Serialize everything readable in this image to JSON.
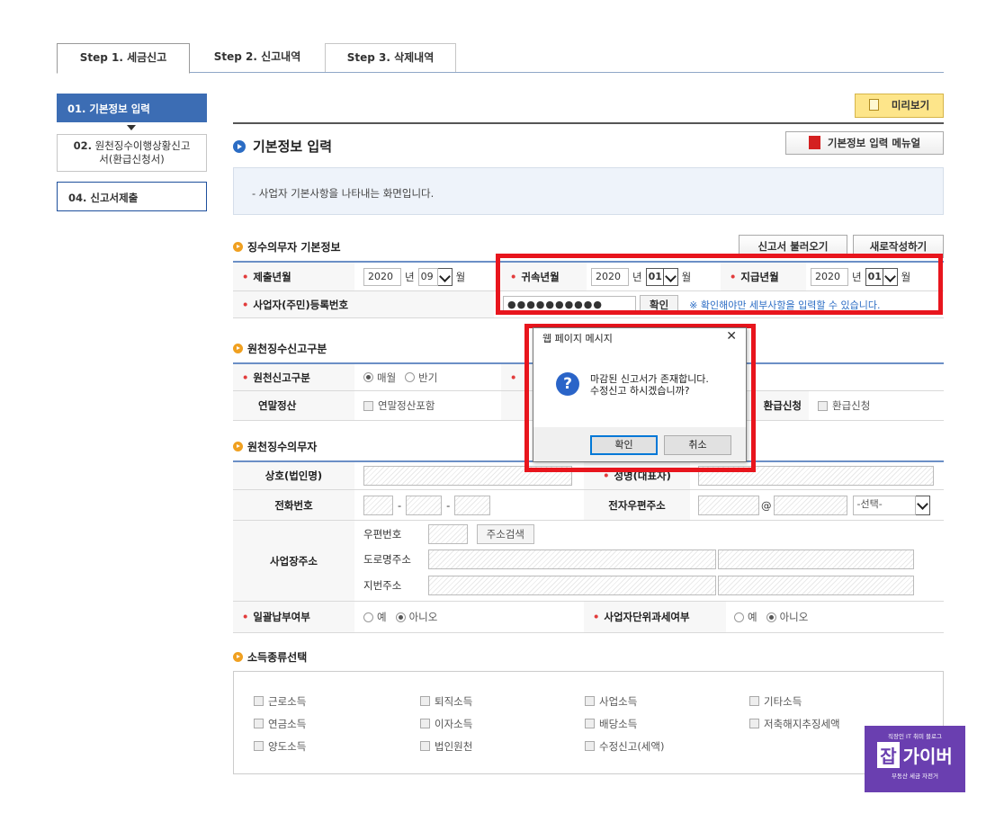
{
  "tabs": [
    {
      "label": "Step 1. 세금신고",
      "active": true
    },
    {
      "label": "Step 2. 신고내역",
      "active": false
    },
    {
      "label": "Step 3. 삭제내역",
      "active": false
    }
  ],
  "sidebar": {
    "items": [
      {
        "label": "01. 기본정보 입력"
      },
      {
        "num": "02.",
        "label_line1": "원천징수이행상황신고",
        "label_line2": "서(환급신청서)"
      },
      {
        "label": "04. 신고서제출"
      }
    ]
  },
  "toolbar": {
    "preview_label": "미리보기",
    "manual_label": "기본정보 입력 메뉴얼"
  },
  "page_title": "기본정보 입력",
  "info_text": "- 사업자 기본사항을 나타내는 화면입니다.",
  "section1": {
    "title": "징수의무자 기본정보",
    "load_label": "신고서 불러오기",
    "new_label": "새로작성하기",
    "submit_ym_label": "제출년월",
    "submit_year": "2020",
    "year_unit": "년",
    "submit_month": "09",
    "month_unit": "월",
    "belong_ym_label": "귀속년월",
    "belong_year": "2020",
    "belong_month": "01",
    "pay_ym_label": "지급년월",
    "pay_year": "2020",
    "pay_month": "01",
    "reg_no_label": "사업자(주민)등록번호",
    "reg_no_value": "●●●●●●●●●●",
    "confirm_label": "확인",
    "notice": "※ 확인해야만 세부사항을 입력할 수 있습니다."
  },
  "section2": {
    "title": "원천징수신고구분",
    "type_label": "원천신고구분",
    "monthly": "매월",
    "half": "반기",
    "yearend_label": "연말정산",
    "yearend_chk": "연말정산포함",
    "refund_label": "환급신청",
    "refund_chk": "환급신청"
  },
  "section3": {
    "title": "원천징수의무자",
    "company_label": "상호(법인명)",
    "ceo_label": "성명(대표자)",
    "phone_label": "전화번호",
    "dash": "-",
    "email_label": "전자우편주소",
    "at": "@",
    "email_select": "-선택-",
    "addr_label": "사업장주소",
    "zip_label": "우편번호",
    "addr_search": "주소검색",
    "road_label": "도로명주소",
    "jibun_label": "지번주소",
    "lump_label": "일괄납부여부",
    "yes": "예",
    "no": "아니오",
    "unit_label": "사업자단위과세여부"
  },
  "section4": {
    "title": "소득종류선택",
    "items": [
      "근로소득",
      "퇴직소득",
      "사업소득",
      "기타소득",
      "연금소득",
      "이자소득",
      "배당소득",
      "저축해지추징세액",
      "양도소득",
      "법인원천",
      "수정신고(세액)"
    ]
  },
  "dialog": {
    "title": "웹 페이지 메시지",
    "close": "✕",
    "icon": "?",
    "line1": "마감된 신고서가 존재합니다.",
    "line2": "수정신고 하시겠습니까?",
    "ok": "확인",
    "cancel": "취소"
  },
  "watermark": {
    "top": "직장인 IT 취미 블로그",
    "box": "잡",
    "main": "가이버",
    "bottom": "부동산 세금 자전거"
  }
}
